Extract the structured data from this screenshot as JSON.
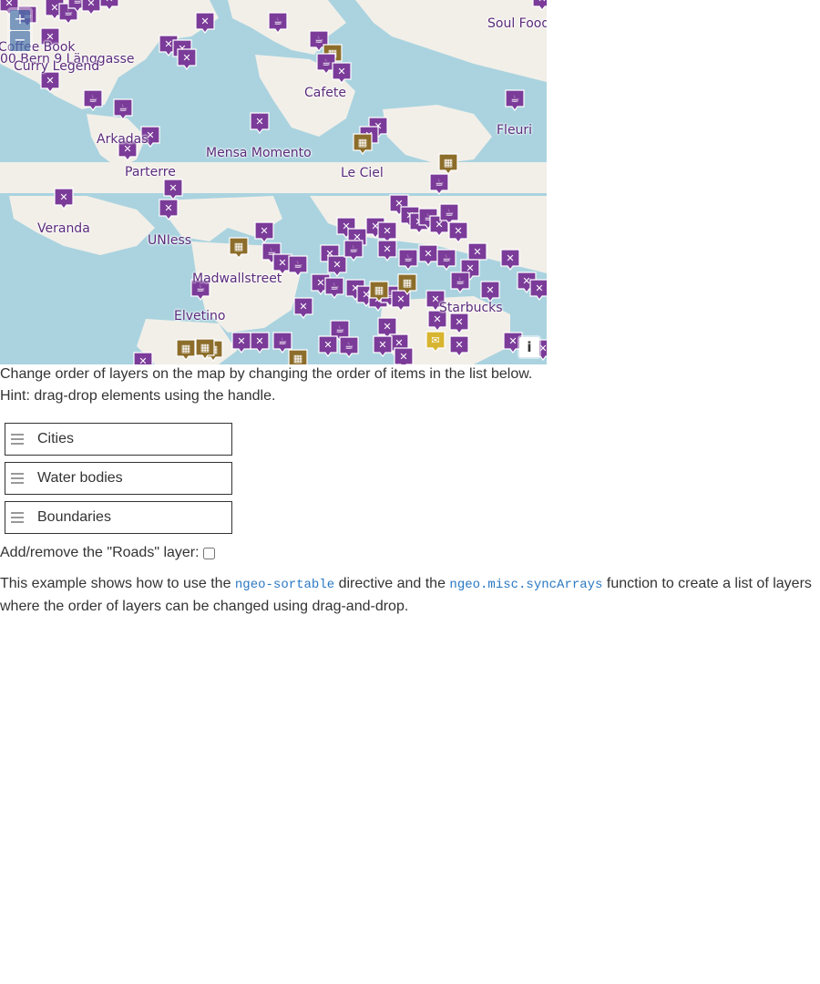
{
  "map": {
    "zoom_in": "+",
    "zoom_out": "−",
    "attribution": "i",
    "labels": [
      "Soul Food",
      "Coffee Book",
      "00 Bern 9 Länggasse",
      "Curry Legend",
      "Cafete",
      "Fleuri",
      "Arkadas",
      "Mensa Momento",
      "Parterre",
      "Le Ciel",
      "Veranda",
      "UNIess",
      "Madwallstreet",
      "Elvetino",
      "Starbucks"
    ],
    "colors": {
      "water": "#aad3df",
      "land": "#f2efe9",
      "pin_restaurant": "#7b3b99",
      "pin_cinema": "#8c6d2a",
      "pin_special": "#d8b530"
    },
    "pin_types": [
      "restaurant-icon",
      "cafe-icon",
      "cinema-icon",
      "theatre-icon"
    ]
  },
  "instructions": {
    "line1": "Change order of layers on the map by changing the order of items in the list below.",
    "line2": "Hint: drag-drop elements using the handle."
  },
  "layers": [
    {
      "name": "Cities"
    },
    {
      "name": "Water bodies"
    },
    {
      "name": "Boundaries"
    }
  ],
  "roads_toggle": {
    "label": "Add/remove the \"Roads\" layer:",
    "checked": false
  },
  "example": {
    "text1": "This example shows how to use the ",
    "code1": "ngeo-sortable",
    "text2": " directive and the ",
    "code2": "ngeo.misc.syncArrays",
    "text3": " function to create a list of layers where the order of layers can be changed using drag-and-drop."
  }
}
